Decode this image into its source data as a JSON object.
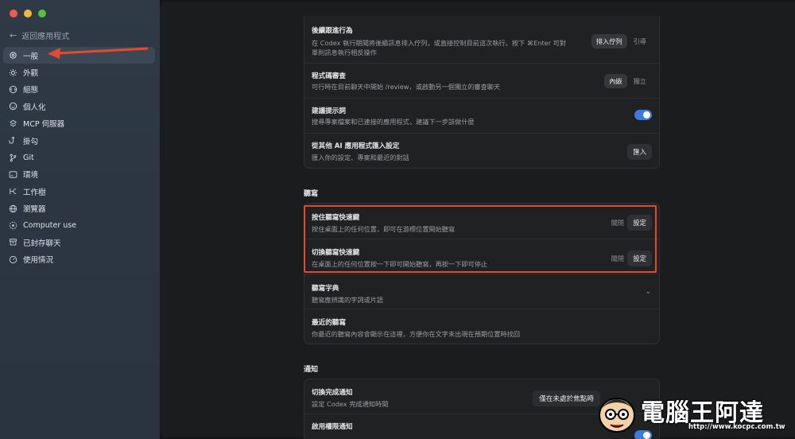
{
  "sidebar": {
    "back_label": "返回應用程式",
    "items": [
      {
        "label": "一般",
        "icon": "gear-icon"
      },
      {
        "label": "外觀",
        "icon": "sun-icon"
      },
      {
        "label": "組態",
        "icon": "config-icon"
      },
      {
        "label": "個人化",
        "icon": "smile-icon"
      },
      {
        "label": "MCP 伺服器",
        "icon": "server-icon"
      },
      {
        "label": "掛勾",
        "icon": "hook-icon"
      },
      {
        "label": "Git",
        "icon": "git-branch-icon"
      },
      {
        "label": "環境",
        "icon": "environment-icon"
      },
      {
        "label": "工作樹",
        "icon": "worktree-icon"
      },
      {
        "label": "瀏覽器",
        "icon": "globe-icon"
      },
      {
        "label": "Computer use",
        "icon": "computer-use-icon"
      },
      {
        "label": "已封存聊天",
        "icon": "archive-icon"
      },
      {
        "label": "使用情況",
        "icon": "gauge-icon"
      }
    ]
  },
  "general": {
    "followup": {
      "title": "後續跟進行為",
      "desc_line1": "在 Codex 執行期間將後續訊息排入佇列，或直接控制目前這次執行。按下 ⌘Enter 可對",
      "desc_line2": "單則訊息執行相反操作",
      "opt_active": "排入佇列",
      "opt_inactive": "引導"
    },
    "review": {
      "title": "程式碼審查",
      "desc": "可行時在目前聊天中開始 /review，或啟動另一個獨立的審查聊天",
      "opt_active": "內嵌",
      "opt_inactive": "獨立"
    },
    "suggest": {
      "title": "建議提示詞",
      "desc": "搜尋專案檔案和已連接的應用程式，建議下一步該做什麼",
      "enabled": true
    },
    "import": {
      "title": "從其他 AI 應用程式匯入設定",
      "desc": "匯入你的設定、專案和最近的對話",
      "button": "匯入"
    }
  },
  "dictation": {
    "section_title": "聽寫",
    "hold": {
      "title": "按住聽寫快速鍵",
      "desc": "按住桌面上的任何位置，即可在游標位置開始聽寫",
      "status": "關閉",
      "button": "設定"
    },
    "toggle": {
      "title": "切換聽寫快速鍵",
      "desc": "在桌面上的任何位置按一下即可開始聽寫，再按一下即可停止",
      "status": "關閉",
      "button": "設定"
    },
    "dictionary": {
      "title": "聽寫字典",
      "desc": "聽寫應辨識的字詞或片語"
    },
    "recent": {
      "title": "最近的聽寫",
      "desc": "你最近的聽寫內容會顯示在這裡，方便你在文字未出現在預期位置時找回"
    }
  },
  "notifications": {
    "section_title": "通知",
    "completion": {
      "title": "切換完成通知",
      "desc": "設定 Codex 完成通知時間",
      "value": "僅在未處於焦點時"
    },
    "permission": {
      "title": "啟用權限通知"
    }
  },
  "watermark": {
    "title": "電腦王阿達",
    "url": "http://www.kocpc.com.tw"
  },
  "colors": {
    "sidebar_bg": "#2e3945",
    "main_bg": "#1b1c1e",
    "accent_toggle": "#3a7be0",
    "annotation_red": "#e44a2e"
  }
}
